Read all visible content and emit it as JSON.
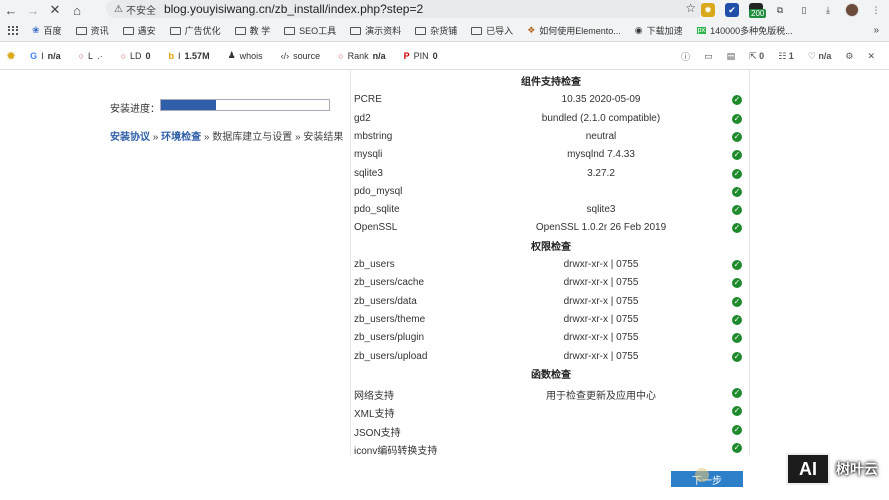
{
  "browser": {
    "insecure_label": "不安全",
    "url": "blog.youyisiwang.cn/zb_install/index.php?step=2",
    "ext_badge": "200"
  },
  "bookmarks": [
    {
      "label": "百度",
      "icon": "paw-icon"
    },
    {
      "label": "资讯",
      "icon": "folder-icon"
    },
    {
      "label": "遇安",
      "icon": "folder-icon"
    },
    {
      "label": "广告优化",
      "icon": "folder-icon"
    },
    {
      "label": "教 学",
      "icon": "folder-icon"
    },
    {
      "label": "SEO工具",
      "icon": "folder-icon"
    },
    {
      "label": "演示资料",
      "icon": "folder-icon"
    },
    {
      "label": "杂货铺",
      "icon": "folder-icon"
    },
    {
      "label": "已导入",
      "icon": "folder-icon"
    },
    {
      "label": "如何使用Elemento...",
      "icon": "page-icon"
    },
    {
      "label": "下载加速",
      "icon": "globe-icon"
    },
    {
      "label": "140000多种免版税...",
      "icon": "px-icon"
    }
  ],
  "seo_toolbar": {
    "google_label": "I",
    "google_value": "n/a",
    "l_label": "L",
    "l_value": ".·",
    "ld_label": "LD",
    "ld_value": "0",
    "bing_label": "I",
    "bing_value": "1.57M",
    "whois": "whois",
    "source": "source",
    "rank_label": "Rank",
    "rank_value": "n/a",
    "pin_label": "PIN",
    "pin_value": "0",
    "right_links": "0",
    "right_one": "1",
    "right_na": "n/a"
  },
  "install": {
    "progress_label": "安装进度：",
    "progress_fraction": 0.33,
    "steps": {
      "step1": "安装协议",
      "sep1": " » ",
      "step2": "环境检查",
      "sep2": " » ",
      "step3": "数据库建立与设置",
      "sep3": " » ",
      "step4": "安装结果"
    },
    "sections": {
      "components": "组件支持检查",
      "permissions": "权限检查",
      "functions": "函数检查"
    },
    "components": [
      {
        "name": "PCRE",
        "value": "10.35 2020-05-09"
      },
      {
        "name": "gd2",
        "value": "bundled (2.1.0 compatible)"
      },
      {
        "name": "mbstring",
        "value": "neutral"
      },
      {
        "name": "mysqli",
        "value": "mysqlnd 7.4.33"
      },
      {
        "name": "sqlite3",
        "value": "3.27.2"
      },
      {
        "name": "pdo_mysql",
        "value": ""
      },
      {
        "name": "pdo_sqlite",
        "value": "sqlite3"
      },
      {
        "name": "OpenSSL",
        "value": "OpenSSL 1.0.2r 26 Feb 2019"
      }
    ],
    "permissions": [
      {
        "name": "zb_users",
        "value": "drwxr-xr-x | 0755"
      },
      {
        "name": "zb_users/cache",
        "value": "drwxr-xr-x | 0755"
      },
      {
        "name": "zb_users/data",
        "value": "drwxr-xr-x | 0755"
      },
      {
        "name": "zb_users/theme",
        "value": "drwxr-xr-x | 0755"
      },
      {
        "name": "zb_users/plugin",
        "value": "drwxr-xr-x | 0755"
      },
      {
        "name": "zb_users/upload",
        "value": "drwxr-xr-x | 0755"
      }
    ],
    "functions": [
      {
        "name": "网络支持",
        "value": "用于检查更新及应用中心"
      },
      {
        "name": "XML支持",
        "value": ""
      },
      {
        "name": "JSON支持",
        "value": ""
      },
      {
        "name": "iconv编码转换支持",
        "value": ""
      }
    ],
    "check_mark": "✓",
    "next_button": "下一步"
  },
  "watermark": {
    "logo": "AI",
    "text": "树叶云"
  }
}
